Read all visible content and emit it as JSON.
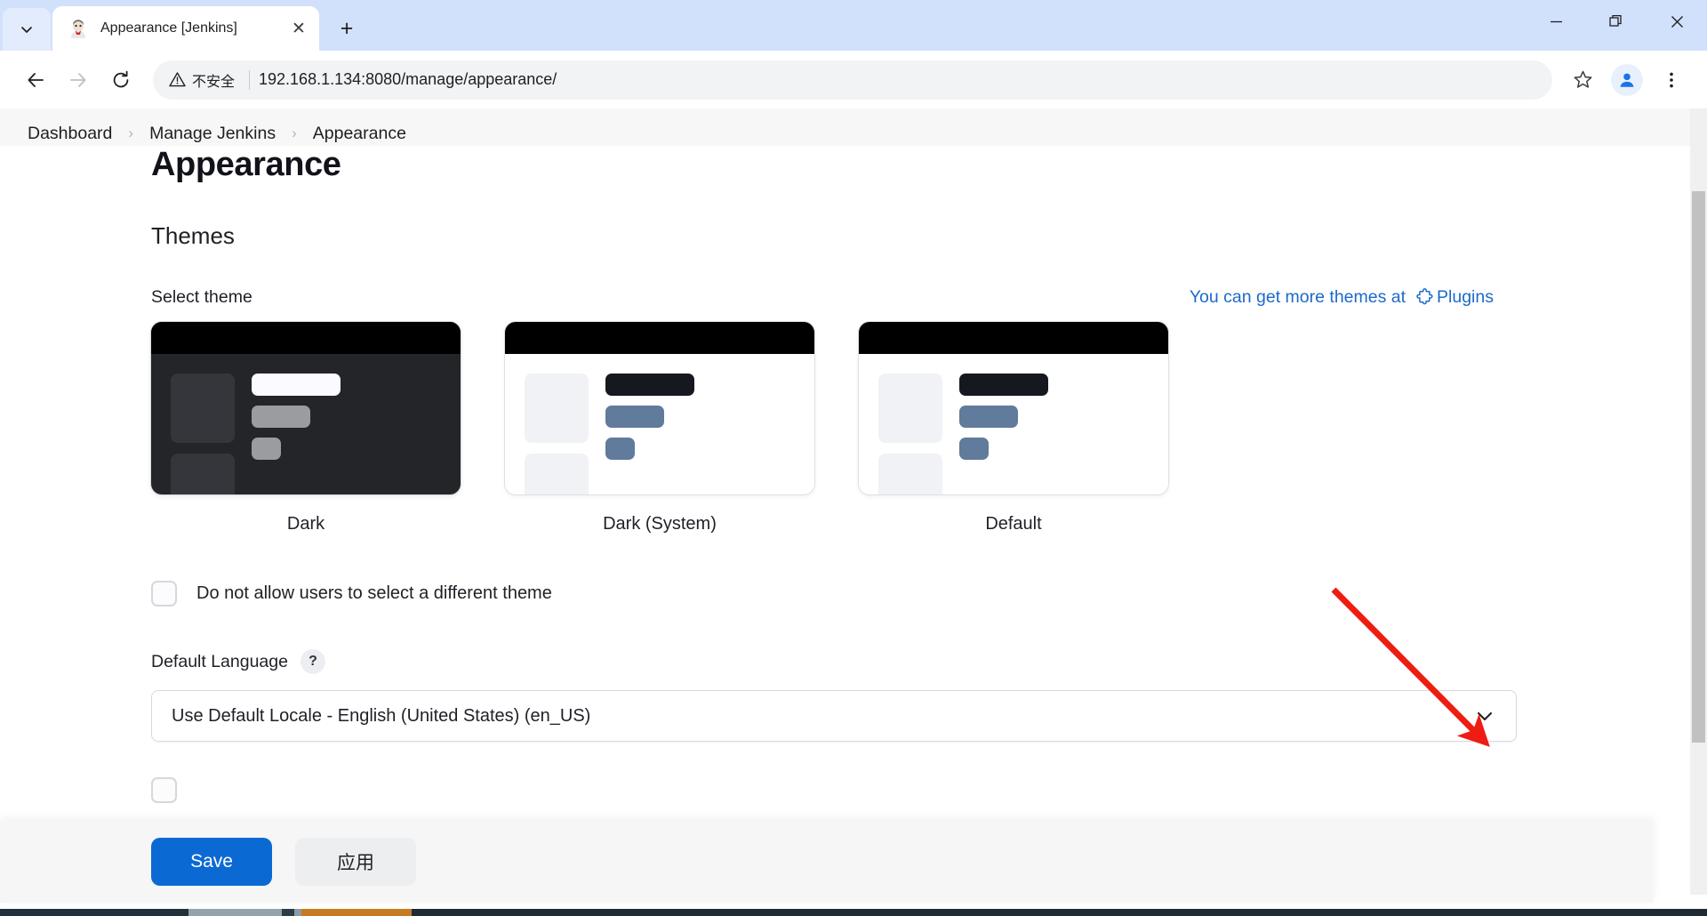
{
  "browser": {
    "tab": {
      "title": "Appearance [Jenkins]",
      "close_label": "✕",
      "favicon_name": "jenkins-favicon"
    },
    "new_tab_label": "+",
    "window_controls": {
      "minimize": "—",
      "maximize": "❐",
      "close": "✕"
    },
    "toolbar": {
      "back": "←",
      "forward": "→",
      "reload": "↻",
      "security_text": "不安全",
      "url": "192.168.1.134:8080/manage/appearance/",
      "bookmark": "☆",
      "menu": "⋮"
    }
  },
  "breadcrumb": {
    "items": [
      "Dashboard",
      "Manage Jenkins",
      "Appearance"
    ],
    "separator": "›"
  },
  "page": {
    "title": "Appearance",
    "section_title": "Themes",
    "select_theme_label": "Select theme",
    "themes_link_text": "You can get more themes at",
    "themes_link_target": "Plugins",
    "themes": [
      {
        "name": "Dark",
        "mode": "dark"
      },
      {
        "name": "Dark (System)",
        "mode": "light"
      },
      {
        "name": "Default",
        "mode": "light"
      }
    ],
    "restrict_checkbox_label": "Do not allow users to select a different theme",
    "restrict_checkbox_checked": false,
    "default_language_label": "Default Language",
    "help_badge": "?",
    "default_language_value": "Use Default Locale - English (United States) (en_US)",
    "dropdown_chevron": "⌄"
  },
  "savebar": {
    "save_label": "Save",
    "apply_label": "应用"
  },
  "colors": {
    "accent_blue": "#0b69d4",
    "link_blue": "#1b6ac9",
    "tabstrip": "#d2e1fb",
    "annotation_red": "#ee1c12",
    "scrollbar_thumb": "#c1c1c1"
  }
}
